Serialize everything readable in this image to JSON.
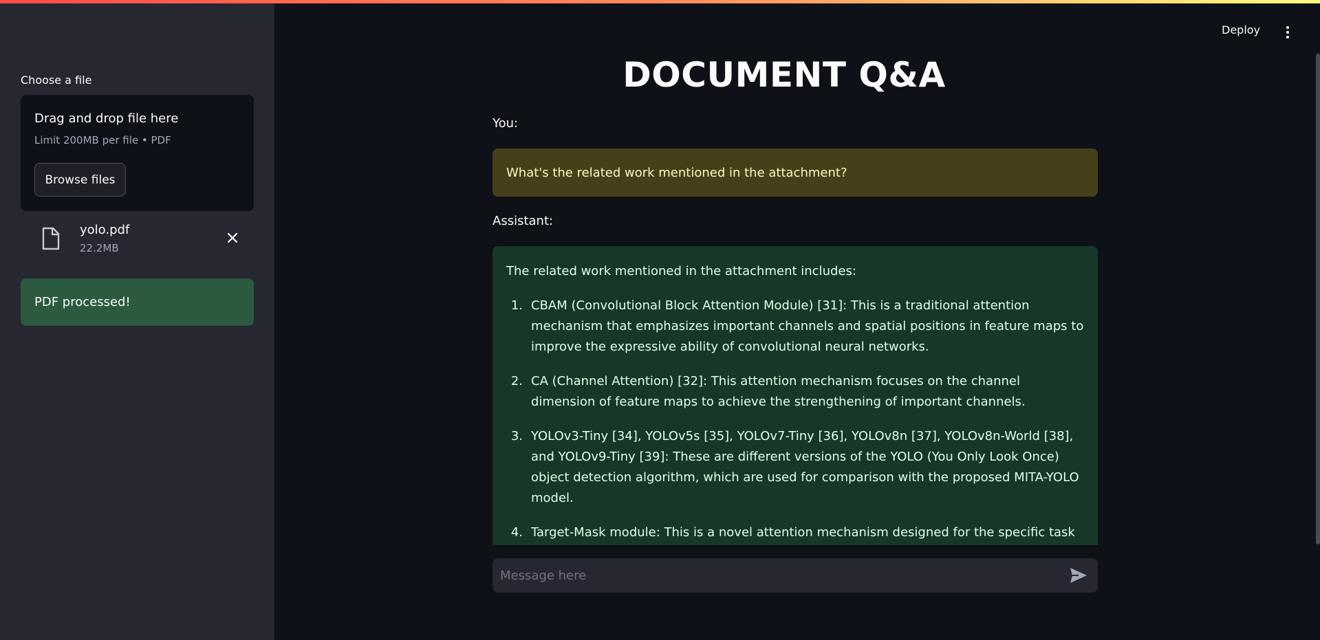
{
  "colors": {
    "top_bar_gradient": [
      "#ff4b4b",
      "#fffd80"
    ],
    "sidebar_bg": "#262730",
    "main_bg": "#0e1117",
    "user_message_bg": "#46401a",
    "assistant_message_bg": "#173828",
    "success_bg": "#2b5a3f"
  },
  "header": {
    "deploy_label": "Deploy",
    "menu_icon": "vertical-dots-icon"
  },
  "sidebar": {
    "uploader_label": "Choose a file",
    "dropzone_title": "Drag and drop file here",
    "dropzone_limit": "Limit 200MB per file • PDF",
    "browse_label": "Browse files",
    "file": {
      "icon": "file-icon",
      "name": "yolo.pdf",
      "size": "22.2MB",
      "remove_icon": "close-icon"
    },
    "status_message": "PDF processed!"
  },
  "main": {
    "title": "DOCUMENT Q&A",
    "user_label": "You:",
    "user_message": "What's the related work mentioned in the attachment?",
    "assistant_label": "Assistant:",
    "assistant_intro": "The related work mentioned in the attachment includes:",
    "assistant_items": [
      {
        "num": "1.",
        "text": "CBAM (Convolutional Block Attention Module) [31]: This is a traditional attention mechanism that emphasizes important channels and spatial positions in feature maps to improve the expressive ability of convolutional neural networks."
      },
      {
        "num": "2.",
        "text": "CA (Channel Attention) [32]: This attention mechanism focuses on the channel dimension of feature maps to achieve the strengthening of important channels."
      },
      {
        "num": "3.",
        "text": "YOLOv3-Tiny [34], YOLOv5s [35], YOLOv7-Tiny [36], YOLOv8n [37], YOLOv8n-World [38], and YOLOv9-Tiny [39]: These are different versions of the YOLO (You Only Look Once) object detection algorithm, which are used for comparison with the proposed MITA-YOLO model."
      },
      {
        "num": "4.",
        "text": "Target-Mask module: This is a novel attention mechanism designed for the specific task of fire detection in cultural relic buildings using indirect vision. It consists of three sub-modules:"
      }
    ],
    "chat_input_placeholder": "Message here",
    "send_icon": "send-icon"
  }
}
